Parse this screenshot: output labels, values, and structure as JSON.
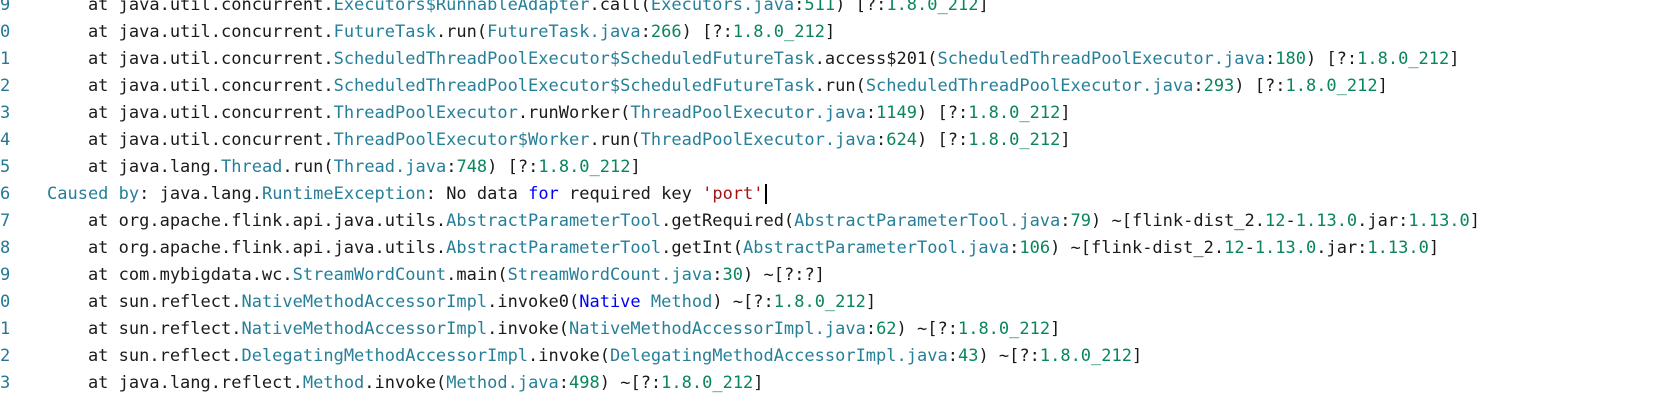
{
  "lines": [
    {
      "n": "9",
      "segs": [
        {
          "t": "    at java.util.concurrent.",
          "c": ""
        },
        {
          "t": "Executors$RunnableAdapter",
          "c": "cls"
        },
        {
          "t": ".call(",
          "c": ""
        },
        {
          "t": "Executors.java",
          "c": "cls"
        },
        {
          "t": ":",
          "c": ""
        },
        {
          "t": "511",
          "c": "num"
        },
        {
          "t": ") [?:",
          "c": ""
        },
        {
          "t": "1.8.0_212",
          "c": "num"
        },
        {
          "t": "]",
          "c": ""
        }
      ]
    },
    {
      "n": "0",
      "segs": [
        {
          "t": "    at java.util.concurrent.",
          "c": ""
        },
        {
          "t": "FutureTask",
          "c": "cls"
        },
        {
          "t": ".run(",
          "c": ""
        },
        {
          "t": "FutureTask.java",
          "c": "cls"
        },
        {
          "t": ":",
          "c": ""
        },
        {
          "t": "266",
          "c": "num"
        },
        {
          "t": ") [?:",
          "c": ""
        },
        {
          "t": "1.8.0_212",
          "c": "num"
        },
        {
          "t": "]",
          "c": ""
        }
      ]
    },
    {
      "n": "1",
      "segs": [
        {
          "t": "    at java.util.concurrent.",
          "c": ""
        },
        {
          "t": "ScheduledThreadPoolExecutor$ScheduledFutureTask",
          "c": "cls"
        },
        {
          "t": ".access$201(",
          "c": ""
        },
        {
          "t": "ScheduledThreadPoolExecutor.java",
          "c": "cls"
        },
        {
          "t": ":",
          "c": ""
        },
        {
          "t": "180",
          "c": "num"
        },
        {
          "t": ") [?:",
          "c": ""
        },
        {
          "t": "1.8.0_212",
          "c": "num"
        },
        {
          "t": "]",
          "c": ""
        }
      ]
    },
    {
      "n": "2",
      "segs": [
        {
          "t": "    at java.util.concurrent.",
          "c": ""
        },
        {
          "t": "ScheduledThreadPoolExecutor$ScheduledFutureTask",
          "c": "cls"
        },
        {
          "t": ".run(",
          "c": ""
        },
        {
          "t": "ScheduledThreadPoolExecutor.java",
          "c": "cls"
        },
        {
          "t": ":",
          "c": ""
        },
        {
          "t": "293",
          "c": "num"
        },
        {
          "t": ") [?:",
          "c": ""
        },
        {
          "t": "1.8.0_212",
          "c": "num"
        },
        {
          "t": "]",
          "c": ""
        }
      ]
    },
    {
      "n": "3",
      "segs": [
        {
          "t": "    at java.util.concurrent.",
          "c": ""
        },
        {
          "t": "ThreadPoolExecutor",
          "c": "cls"
        },
        {
          "t": ".runWorker(",
          "c": ""
        },
        {
          "t": "ThreadPoolExecutor.java",
          "c": "cls"
        },
        {
          "t": ":",
          "c": ""
        },
        {
          "t": "1149",
          "c": "num"
        },
        {
          "t": ") [?:",
          "c": ""
        },
        {
          "t": "1.8.0_212",
          "c": "num"
        },
        {
          "t": "]",
          "c": ""
        }
      ]
    },
    {
      "n": "4",
      "segs": [
        {
          "t": "    at java.util.concurrent.",
          "c": ""
        },
        {
          "t": "ThreadPoolExecutor$Worker",
          "c": "cls"
        },
        {
          "t": ".run(",
          "c": ""
        },
        {
          "t": "ThreadPoolExecutor.java",
          "c": "cls"
        },
        {
          "t": ":",
          "c": ""
        },
        {
          "t": "624",
          "c": "num"
        },
        {
          "t": ") [?:",
          "c": ""
        },
        {
          "t": "1.8.0_212",
          "c": "num"
        },
        {
          "t": "]",
          "c": ""
        }
      ]
    },
    {
      "n": "5",
      "segs": [
        {
          "t": "    at java.lang.",
          "c": ""
        },
        {
          "t": "Thread",
          "c": "cls"
        },
        {
          "t": ".run(",
          "c": ""
        },
        {
          "t": "Thread.java",
          "c": "cls"
        },
        {
          "t": ":",
          "c": ""
        },
        {
          "t": "748",
          "c": "num"
        },
        {
          "t": ") [?:",
          "c": ""
        },
        {
          "t": "1.8.0_212",
          "c": "num"
        },
        {
          "t": "]",
          "c": ""
        }
      ]
    },
    {
      "n": "6",
      "cursor": true,
      "segs": [
        {
          "t": "Caused by",
          "c": "caused"
        },
        {
          "t": ": java.lang.",
          "c": ""
        },
        {
          "t": "RuntimeException",
          "c": "cls"
        },
        {
          "t": ": No data ",
          "c": ""
        },
        {
          "t": "for",
          "c": "kw"
        },
        {
          "t": " required key ",
          "c": ""
        },
        {
          "t": "'port'",
          "c": "str"
        }
      ]
    },
    {
      "n": "7",
      "segs": [
        {
          "t": "    at org.apache.flink.api.java.utils.",
          "c": ""
        },
        {
          "t": "AbstractParameterTool",
          "c": "cls"
        },
        {
          "t": ".getRequired(",
          "c": ""
        },
        {
          "t": "AbstractParameterTool.java",
          "c": "cls"
        },
        {
          "t": ":",
          "c": ""
        },
        {
          "t": "79",
          "c": "num"
        },
        {
          "t": ") ~[flink-dist_2.",
          "c": ""
        },
        {
          "t": "12",
          "c": "num"
        },
        {
          "t": "-",
          "c": ""
        },
        {
          "t": "1.13.0",
          "c": "num"
        },
        {
          "t": ".jar:",
          "c": ""
        },
        {
          "t": "1.13.0",
          "c": "num"
        },
        {
          "t": "]",
          "c": ""
        }
      ]
    },
    {
      "n": "8",
      "segs": [
        {
          "t": "    at org.apache.flink.api.java.utils.",
          "c": ""
        },
        {
          "t": "AbstractParameterTool",
          "c": "cls"
        },
        {
          "t": ".getInt(",
          "c": ""
        },
        {
          "t": "AbstractParameterTool.java",
          "c": "cls"
        },
        {
          "t": ":",
          "c": ""
        },
        {
          "t": "106",
          "c": "num"
        },
        {
          "t": ") ~[flink-dist_2.",
          "c": ""
        },
        {
          "t": "12",
          "c": "num"
        },
        {
          "t": "-",
          "c": ""
        },
        {
          "t": "1.13.0",
          "c": "num"
        },
        {
          "t": ".jar:",
          "c": ""
        },
        {
          "t": "1.13.0",
          "c": "num"
        },
        {
          "t": "]",
          "c": ""
        }
      ]
    },
    {
      "n": "9",
      "segs": [
        {
          "t": "    at com.mybigdata.wc.",
          "c": ""
        },
        {
          "t": "StreamWordCount",
          "c": "cls"
        },
        {
          "t": ".main(",
          "c": ""
        },
        {
          "t": "StreamWordCount.java",
          "c": "cls"
        },
        {
          "t": ":",
          "c": ""
        },
        {
          "t": "30",
          "c": "num"
        },
        {
          "t": ") ~[?:?]",
          "c": ""
        }
      ]
    },
    {
      "n": "0",
      "segs": [
        {
          "t": "    at sun.reflect.",
          "c": ""
        },
        {
          "t": "NativeMethodAccessorImpl",
          "c": "cls"
        },
        {
          "t": ".invoke0(",
          "c": ""
        },
        {
          "t": "Native",
          "c": "kw"
        },
        {
          "t": " ",
          "c": ""
        },
        {
          "t": "Method",
          "c": "cls"
        },
        {
          "t": ") ~[?:",
          "c": ""
        },
        {
          "t": "1.8.0_212",
          "c": "num"
        },
        {
          "t": "]",
          "c": ""
        }
      ]
    },
    {
      "n": "1",
      "segs": [
        {
          "t": "    at sun.reflect.",
          "c": ""
        },
        {
          "t": "NativeMethodAccessorImpl",
          "c": "cls"
        },
        {
          "t": ".invoke(",
          "c": ""
        },
        {
          "t": "NativeMethodAccessorImpl.java",
          "c": "cls"
        },
        {
          "t": ":",
          "c": ""
        },
        {
          "t": "62",
          "c": "num"
        },
        {
          "t": ") ~[?:",
          "c": ""
        },
        {
          "t": "1.8.0_212",
          "c": "num"
        },
        {
          "t": "]",
          "c": ""
        }
      ]
    },
    {
      "n": "2",
      "segs": [
        {
          "t": "    at sun.reflect.",
          "c": ""
        },
        {
          "t": "DelegatingMethodAccessorImpl",
          "c": "cls"
        },
        {
          "t": ".invoke(",
          "c": ""
        },
        {
          "t": "DelegatingMethodAccessorImpl.java",
          "c": "cls"
        },
        {
          "t": ":",
          "c": ""
        },
        {
          "t": "43",
          "c": "num"
        },
        {
          "t": ") ~[?:",
          "c": ""
        },
        {
          "t": "1.8.0_212",
          "c": "num"
        },
        {
          "t": "]",
          "c": ""
        }
      ]
    },
    {
      "n": "3",
      "segs": [
        {
          "t": "    at java.lang.reflect.",
          "c": ""
        },
        {
          "t": "Method",
          "c": "cls"
        },
        {
          "t": ".invoke(",
          "c": ""
        },
        {
          "t": "Method.java",
          "c": "cls"
        },
        {
          "t": ":",
          "c": ""
        },
        {
          "t": "498",
          "c": "num"
        },
        {
          "t": ") ~[?:",
          "c": ""
        },
        {
          "t": "1.8.0_212",
          "c": "num"
        },
        {
          "t": "]",
          "c": ""
        }
      ]
    }
  ]
}
